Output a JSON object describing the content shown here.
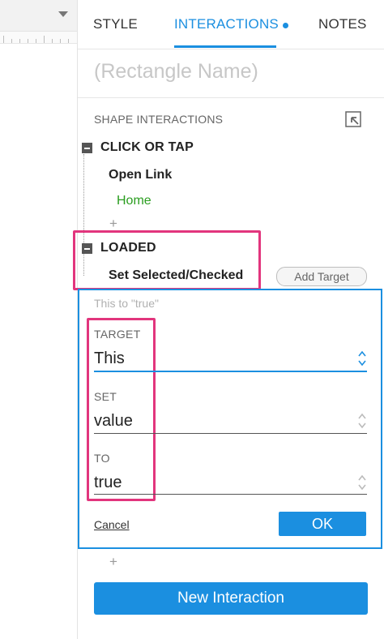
{
  "tabs": {
    "style": "STYLE",
    "interactions": "INTERACTIONS",
    "notes": "NOTES"
  },
  "shape": {
    "name_placeholder": "(Rectangle Name)"
  },
  "section": {
    "title": "SHAPE INTERACTIONS"
  },
  "events": [
    {
      "title": "CLICK OR TAP",
      "action": "Open Link",
      "target": "Home"
    },
    {
      "title": "LOADED",
      "action": "Set Selected/Checked",
      "add_target_label": "Add Target"
    }
  ],
  "editor": {
    "summary": "This to \"true\"",
    "fields": [
      {
        "label": "TARGET",
        "value": "This"
      },
      {
        "label": "SET",
        "value": "value"
      },
      {
        "label": "TO",
        "value": "true"
      }
    ],
    "cancel_label": "Cancel",
    "ok_label": "OK"
  },
  "plus_glyph": "+",
  "new_interaction_label": "New Interaction",
  "colors": {
    "accent": "#1b8fe0",
    "highlight": "#e2357d",
    "link": "#2a9d1f"
  }
}
